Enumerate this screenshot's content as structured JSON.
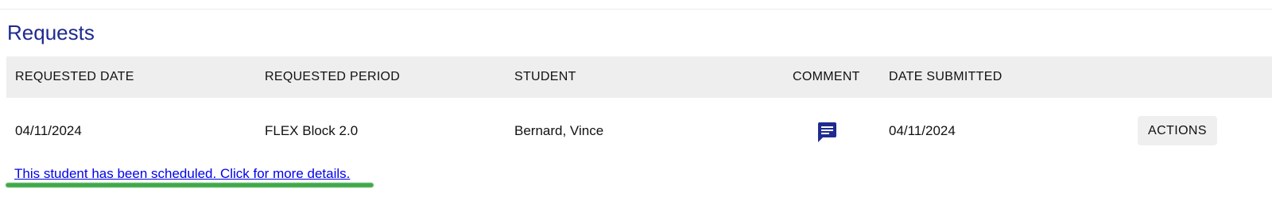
{
  "page": {
    "title": "Requests"
  },
  "table": {
    "headers": {
      "requested_date": "REQUESTED DATE",
      "requested_period": "REQUESTED PERIOD",
      "student": "STUDENT",
      "comment": "COMMENT",
      "date_submitted": "DATE SUBMITTED"
    },
    "rows": [
      {
        "requested_date": "04/11/2024",
        "requested_period": "FLEX Block 2.0",
        "student": "Bernard, Vince",
        "comment_icon": "comment-icon",
        "date_submitted": "04/11/2024",
        "actions_label": "ACTIONS"
      }
    ]
  },
  "notice": {
    "link_text": "This student has been scheduled. Click for more details."
  },
  "colors": {
    "title": "#1f2b8f",
    "header_bg": "#eeeeee",
    "comment_icon": "#1f2b8f",
    "link": "#0000ee",
    "highlight": "#1f9a2a",
    "button_bg": "#efefef"
  }
}
